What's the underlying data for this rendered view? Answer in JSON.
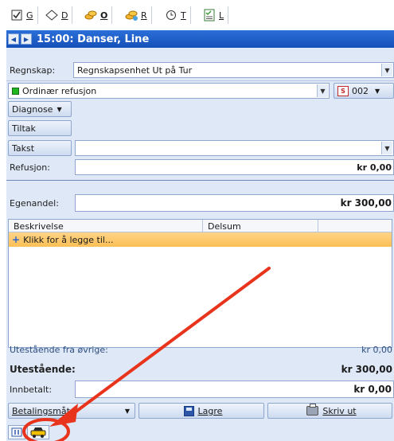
{
  "tabs": [
    {
      "key": "G",
      "label": "G",
      "icon": "checkbox-icon"
    },
    {
      "key": "D",
      "label": "D",
      "icon": "diamond-icon"
    },
    {
      "key": "O",
      "label": "O",
      "icon": "coins-icon",
      "active": true
    },
    {
      "key": "R",
      "label": "R",
      "icon": "coins-star-icon"
    },
    {
      "key": "T",
      "label": "T",
      "icon": "clock-icon"
    },
    {
      "key": "L",
      "label": "L",
      "icon": "checklist-icon"
    }
  ],
  "title": "15:00: Danser, Line",
  "fields": {
    "regnskap_label": "Regnskap:",
    "regnskap_value": "Regnskapsenhet Ut på Tur",
    "refusjon_type_value": "Ordinær refusjon",
    "code_value": "002",
    "diagnose_label": "Diagnose",
    "tiltak_label": "Tiltak",
    "takst_label": "Takst",
    "takst_value": "",
    "refusjon_label": "Refusjon:",
    "refusjon_amount": "kr 0,00",
    "egenandel_label": "Egenandel:",
    "egenandel_amount": "kr 300,00"
  },
  "grid": {
    "columns": [
      "Beskrivelse",
      "Delsum"
    ],
    "add_row_label": "Klikk for å legge til..."
  },
  "summary": {
    "utestaende_ovrige_label": "Utestående fra øvrige:",
    "utestaende_ovrige_amount": "kr 0,00",
    "utestaende_label": "Utestående:",
    "utestaende_amount": "kr 300,00",
    "innbetalt_label": "Innbetalt:",
    "innbetalt_amount": "kr 0,00"
  },
  "actions": {
    "betalingsmate_label": "Betalingsmåte",
    "lagre_label": "Lagre",
    "skriv_ut_label": "Skriv ut"
  },
  "colors": {
    "title_bar": "#1a5cc8",
    "panel": "#dfe8f6",
    "add_row": "#fcc66a",
    "annotation": "#e8341c"
  }
}
